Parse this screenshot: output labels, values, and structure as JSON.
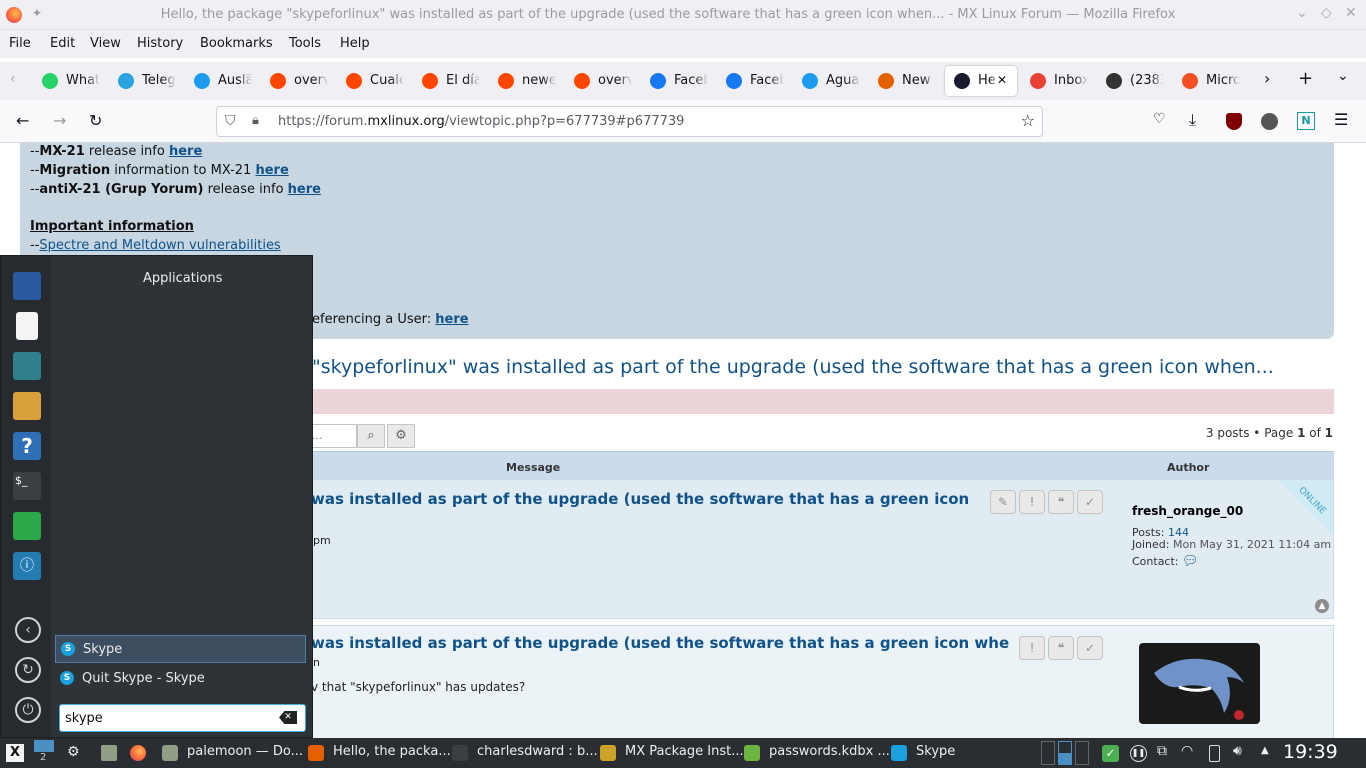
{
  "window": {
    "title": "Hello, the package \"skypeforlinux\" was installed as part of the upgrade (used the software that has a green icon when... - MX Linux Forum — Mozilla Firefox"
  },
  "menubar": [
    "File",
    "Edit",
    "View",
    "History",
    "Bookmarks",
    "Tools",
    "Help"
  ],
  "tabs": [
    {
      "label": "What",
      "color": "#25d366"
    },
    {
      "label": "Teleg",
      "color": "#2aa3df"
    },
    {
      "label": "Auslä",
      "color": "#1d9bf0"
    },
    {
      "label": "overv",
      "color": "#ff4500"
    },
    {
      "label": "Cuale",
      "color": "#ff4500"
    },
    {
      "label": "El día",
      "color": "#ff4500"
    },
    {
      "label": "newe",
      "color": "#ff4500"
    },
    {
      "label": "overv",
      "color": "#ff4500"
    },
    {
      "label": "Faceb",
      "color": "#1877f2"
    },
    {
      "label": "Faceb",
      "color": "#1877f2"
    },
    {
      "label": "Agua",
      "color": "#1d9bf0"
    },
    {
      "label": "New",
      "color": "#e66000"
    },
    {
      "label": "He",
      "color": "#1b1b2f",
      "active": true
    },
    {
      "label": "Inbox",
      "color": "#ea4335"
    },
    {
      "label": "(2383",
      "color": "#333333"
    },
    {
      "label": "Micro",
      "color": "#f25022"
    }
  ],
  "url": {
    "prefix": "https://forum.",
    "domain": "mxlinux.org",
    "path": "/viewtopic.php?p=677739#p677739"
  },
  "info": {
    "mx21_prefix": "--",
    "mx21_bold": "MX-21",
    "mx21_text": " release info ",
    "here": "here",
    "migration_bold": "Migration",
    "migration_text": " information to MX-21 ",
    "antix_bold": "antiX-21 (Grup Yorum)",
    "antix_text": " release info ",
    "important": "Important information",
    "spectre": "Spectre and Meltdown vulnerabilities",
    "referencing": "eferencing a User: "
  },
  "topic_title": "\"skypeforlinux\" was installed as part of the upgrade (used the software that has a green icon when...",
  "pagination": {
    "posts": "3 posts • Page ",
    "page": "1",
    "of": " of ",
    "total": "1"
  },
  "table_headers": {
    "message": "Message",
    "author": "Author"
  },
  "posts": [
    {
      "title": "was installed as part of the upgrade (used the software that has a green icon",
      "snippet": "pm",
      "author": "fresh_orange_00",
      "posts_label": "Posts:",
      "posts_count": "144",
      "joined_label": "Joined:",
      "joined": "Mon May 31, 2021 11:04 am",
      "contact_label": "Contact:",
      "status": "ONLINE"
    },
    {
      "title": "was installed as part of the upgrade (used the software that has a green icon whe",
      "snippet1": "n",
      "snippet2": "v that \"skypeforlinux\" has updates?"
    }
  ],
  "app_menu": {
    "header": "Applications",
    "results": [
      {
        "label": "Skype"
      },
      {
        "label": "Quit Skype - Skype"
      }
    ],
    "search_value": "skype"
  },
  "taskbar": {
    "workspace": "2",
    "items": [
      {
        "label": "palemoon — Do...",
        "color": "#8f9e85"
      },
      {
        "label": "Hello, the packa...",
        "color": "#e66000"
      },
      {
        "label": "charlesdward : b...",
        "color": "#3a3f44"
      },
      {
        "label": "MX Package Inst...",
        "color": "#c9a227"
      },
      {
        "label": "passwords.kdbx ...",
        "color": "#6db33f"
      },
      {
        "label": "Skype",
        "color": "#1aa1e0"
      }
    ],
    "clock": "19:39"
  }
}
